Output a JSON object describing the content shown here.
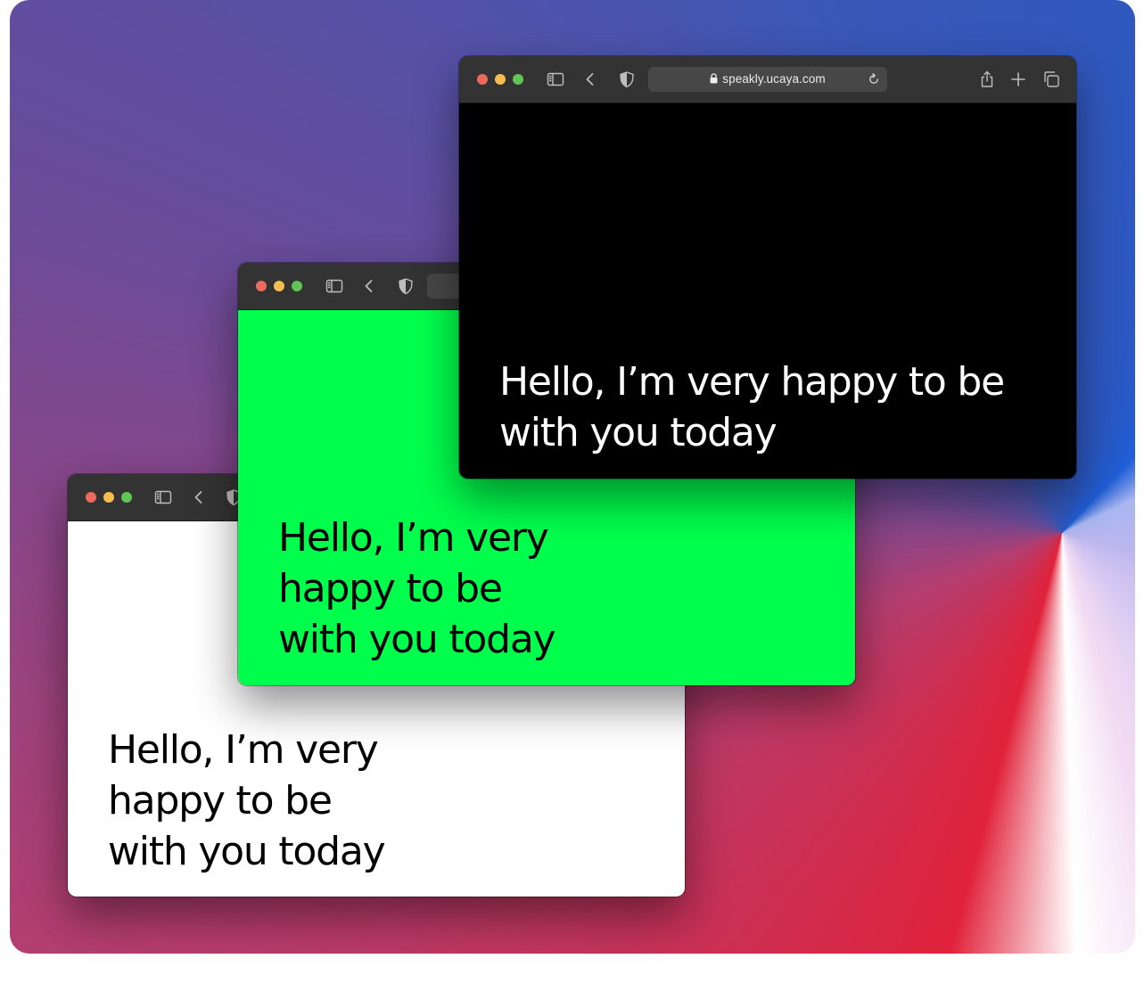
{
  "colors": {
    "toolbar_bg": "#333333",
    "accent_blue": "#1f5ed6",
    "accent_red": "#e0223a",
    "green_screen": "#00ff4d"
  },
  "windows": [
    {
      "id": "white",
      "background": "#ffffff",
      "text_color": "#000000",
      "caption": "Hello, I’m very\nhappy to be\nwith you today"
    },
    {
      "id": "green",
      "background": "#00ff4d",
      "text_color": "#000000",
      "caption": "Hello, I’m very\nhappy to be\nwith you today"
    },
    {
      "id": "black",
      "background": "#000000",
      "text_color": "#ffffff",
      "caption": "Hello, I’m very happy to be\nwith you today",
      "address_bar": {
        "url": "speakly.ucaya.com"
      }
    }
  ],
  "icons": {
    "toolbar_left": [
      "sidebar-icon",
      "back-chevron-icon",
      "privacy-shield-icon"
    ],
    "address": [
      "lock-icon",
      "reload-icon"
    ],
    "toolbar_right": [
      "share-icon",
      "new-tab-plus-icon",
      "tab-overview-icon"
    ]
  }
}
